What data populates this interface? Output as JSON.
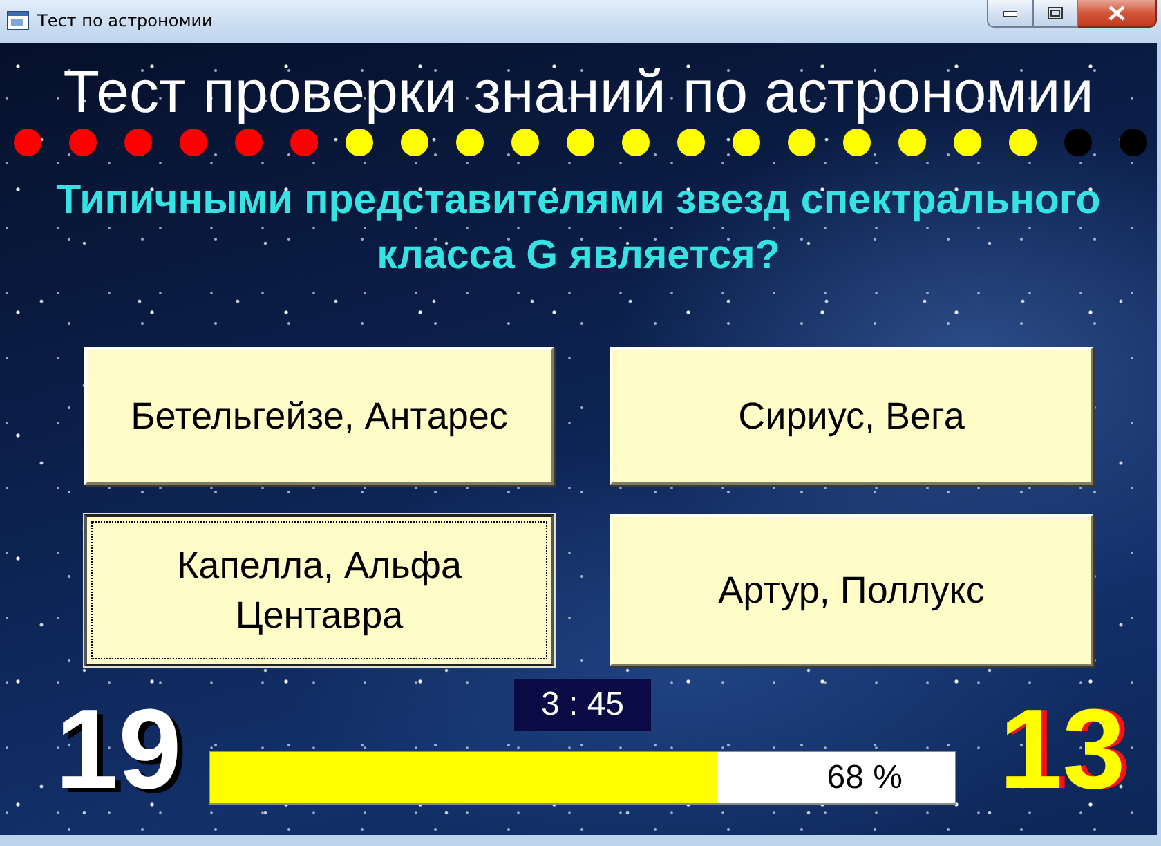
{
  "window": {
    "title": "Тест по астрономии"
  },
  "quiz": {
    "heading": "Тест проверки знаний по астрономии",
    "progress_dots": [
      {
        "color": "#ff0000"
      },
      {
        "color": "#ff0000"
      },
      {
        "color": "#ff0000"
      },
      {
        "color": "#ff0000"
      },
      {
        "color": "#ff0000"
      },
      {
        "color": "#ff0000"
      },
      {
        "color": "#ffff00"
      },
      {
        "color": "#ffff00"
      },
      {
        "color": "#ffff00"
      },
      {
        "color": "#ffff00"
      },
      {
        "color": "#ffff00"
      },
      {
        "color": "#ffff00"
      },
      {
        "color": "#ffff00"
      },
      {
        "color": "#ffff00"
      },
      {
        "color": "#ffff00"
      },
      {
        "color": "#ffff00"
      },
      {
        "color": "#ffff00"
      },
      {
        "color": "#ffff00"
      },
      {
        "color": "#ffff00"
      },
      {
        "color": "#000000"
      },
      {
        "color": "#000000"
      }
    ],
    "question": "Типичными представителями звезд спектрального класса G является?",
    "answers": [
      {
        "text": "Бетельгейзе, Антарес",
        "selected": false
      },
      {
        "text": "Сириус, Вега",
        "selected": false
      },
      {
        "text": "Капелла, Альфа Центавра",
        "selected": true
      },
      {
        "text": "Артур, Поллукс",
        "selected": false
      }
    ],
    "timer": "3 : 45",
    "left_counter": "19",
    "progress": {
      "level": 0.68,
      "reading": "68 %"
    },
    "right_counter": "13"
  }
}
